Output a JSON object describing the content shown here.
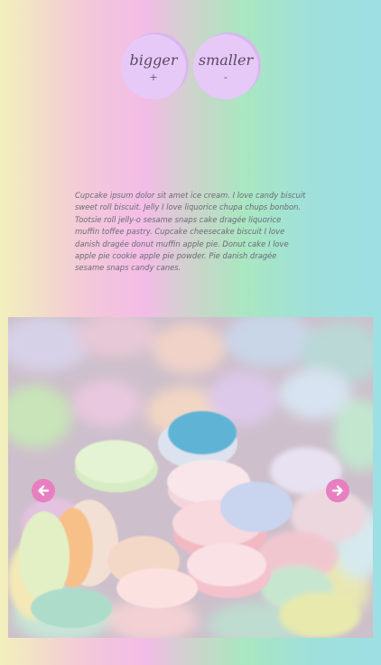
{
  "controls": {
    "bigger": {
      "label": "bigger",
      "symbol": "+"
    },
    "smaller": {
      "label": "smaller",
      "symbol": "-"
    }
  },
  "content": {
    "paragraph": "Cupcake ipsum dolor sit amet ice cream. I love candy biscuit sweet roll biscuit. Jelly I love liquorice chupa chups bonbon. Tootsie roll jelly-o sesame snaps cake dragée liquorice muffin toffee pastry. Cupcake cheesecake biscuit I love danish dragée donut muffin apple pie. Donut cake I love apple pie cookie apple pie powder. Pie danish dragée sesame snaps candy canes."
  },
  "carousel": {
    "image_description": "pastel candy tablets",
    "prev_icon": "arrow-left-icon",
    "next_icon": "arrow-right-icon",
    "arrow_color": "#e77fc0"
  },
  "colors": {
    "gradient": [
      "#f2f0bc",
      "#f3bce6",
      "#a9e7c1",
      "#9edfe4"
    ],
    "button_face": "#e6c9f7",
    "button_shadow": "#d9b6ee",
    "text": "#6b6a78"
  }
}
